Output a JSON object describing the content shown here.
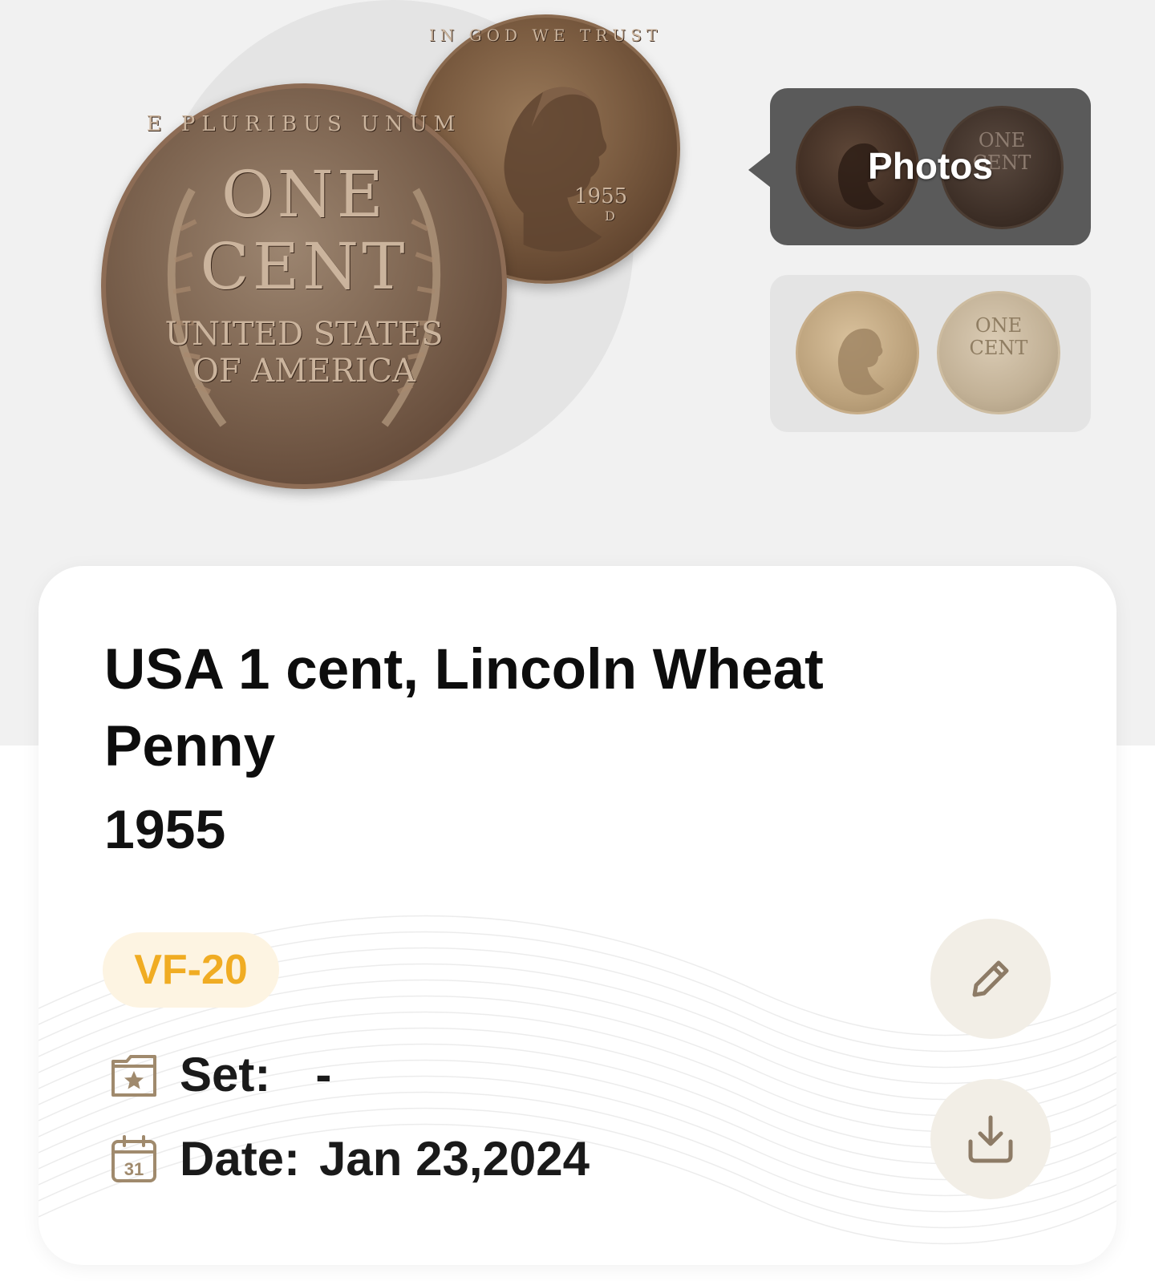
{
  "gallery": {
    "photos_label": "Photos",
    "main_obverse": {
      "motto": "IN GOD WE TRUST",
      "year": "1955",
      "mint": "D"
    },
    "main_reverse": {
      "legend": "E PLURIBUS UNUM",
      "denomination_line1": "ONE",
      "denomination_line2": "CENT",
      "country_line1": "UNITED STATES",
      "country_line2": "OF AMERICA"
    },
    "reference_reverse": {
      "line1": "ONE",
      "line2": "CENT"
    }
  },
  "coin": {
    "title": "USA 1 cent, Lincoln Wheat Penny",
    "year": "1955",
    "grade": "VF-20",
    "set_label": "Set:",
    "set_value": "-",
    "date_label": "Date:",
    "date_value": "Jan 23,2024",
    "calendar_day": "31"
  },
  "icons": {
    "set": "folder-star-icon",
    "date": "calendar-icon",
    "edit": "pencil-icon",
    "download": "download-icon"
  },
  "colors": {
    "grade_text": "#f0ac23",
    "grade_bg": "#fdf4e2",
    "icon_accent": "#a08a6d",
    "action_bg": "#f2eee6"
  }
}
